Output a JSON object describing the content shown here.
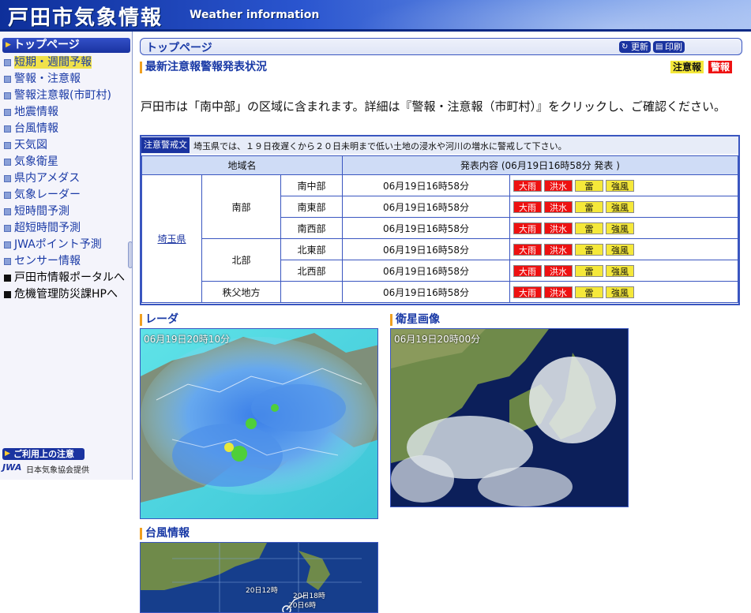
{
  "header": {
    "title": "戸田市気象情報",
    "subtitle": "Weather information"
  },
  "sidebar": {
    "top": "トップページ",
    "items": [
      {
        "label": "短期・週間予報",
        "highlight": true
      },
      {
        "label": "警報・注意報"
      },
      {
        "label": "警報注意報(市町村)"
      },
      {
        "label": "地震情報"
      },
      {
        "label": "台風情報"
      },
      {
        "label": "天気図"
      },
      {
        "label": "気象衛星"
      },
      {
        "label": "県内アメダス"
      },
      {
        "label": "気象レーダー"
      },
      {
        "label": "短時間予測"
      },
      {
        "label": "超短時間予測"
      },
      {
        "label": "JWAポイント予測"
      },
      {
        "label": "センサー情報"
      },
      {
        "label": "戸田市情報ポータルへ",
        "external": true
      },
      {
        "label": "危機管理防災課HPへ",
        "external": true
      }
    ],
    "notice": "ご利用上の注意",
    "jwa_logo": "JWA",
    "provider": "日本気象協会提供"
  },
  "main": {
    "page_title": "トップページ",
    "update": "更新",
    "print": "印刷",
    "alert_heading": "最新注意報警報発表状況",
    "legend": {
      "advisory": "注意報",
      "warning": "警報"
    },
    "intro": "戸田市は「南中部」の区域に含まれます。詳細は『警報・注意報（市町村）』をクリックし、ご確認ください。",
    "warning_label": "注意警戒文",
    "warning_text": "埼玉県では、１９日夜遅くから２０日未明まで低い土地の浸水や河川の増水に警戒して下さい。",
    "table": {
      "col_area": "地域名",
      "col_content": "発表内容 (06月19日16時58分 発表 )",
      "prefecture": "埼玉県",
      "groups": [
        {
          "name": "南部",
          "rows": [
            {
              "sub": "南中部",
              "time": "06月19日16時58分"
            },
            {
              "sub": "南東部",
              "time": "06月19日16時58分"
            },
            {
              "sub": "南西部",
              "time": "06月19日16時58分"
            }
          ]
        },
        {
          "name": "北部",
          "rows": [
            {
              "sub": "北東部",
              "time": "06月19日16時58分"
            },
            {
              "sub": "北西部",
              "time": "06月19日16時58分"
            }
          ]
        },
        {
          "name": "秩父地方",
          "rows": [
            {
              "sub": "",
              "time": "06月19日16時58分"
            }
          ]
        }
      ],
      "tags": [
        {
          "label": "大雨",
          "level": "warning"
        },
        {
          "label": "洪水",
          "level": "warning"
        },
        {
          "label": "雷",
          "level": "advisory"
        },
        {
          "label": "強風",
          "level": "advisory"
        }
      ]
    },
    "radar": {
      "heading": "レーダ",
      "timestamp": "06月19日20時10分"
    },
    "satellite": {
      "heading": "衛星画像",
      "timestamp": "06月19日20時00分"
    },
    "typhoon": {
      "heading": "台風情報",
      "labels": [
        "20日12時",
        "20日18時",
        "20日6時"
      ]
    }
  },
  "colors": {
    "header_blue": "#1a33a0",
    "warning_red": "#ee1111",
    "advisory_yellow": "#f5e83a",
    "accent_orange": "#f0a020"
  }
}
